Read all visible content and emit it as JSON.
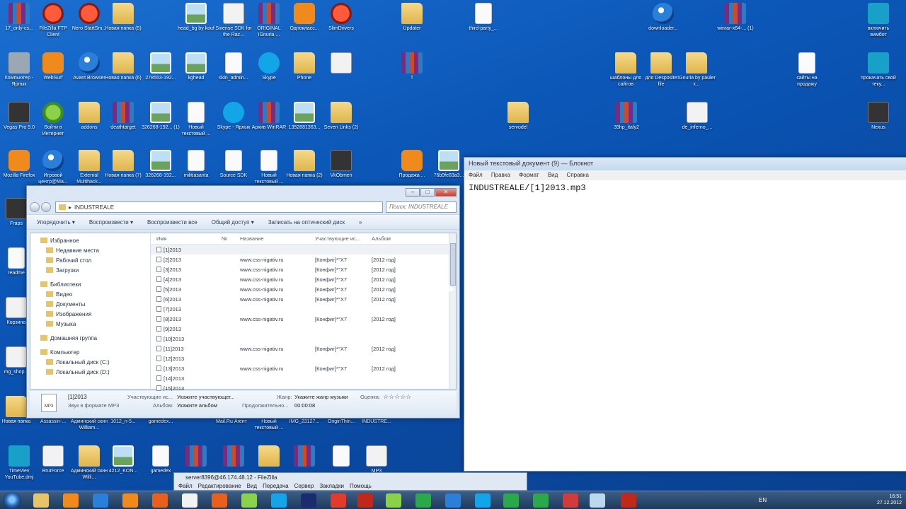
{
  "desktop": {
    "icons": [
      {
        "label": "17_only-cs...",
        "glyph": "rar"
      },
      {
        "label": "FileZilla FTP Client",
        "glyph": "red"
      },
      {
        "label": "Nero StartSm...",
        "glyph": "red"
      },
      {
        "label": "Новая папка (5)",
        "glyph": "folder"
      },
      {
        "label": "head_bg by kouf",
        "glyph": "img"
      },
      {
        "label": "Sixense SDK for the Raz...",
        "glyph": "white"
      },
      {
        "label": "ORIGINAL IGnuria ...",
        "glyph": "rar"
      },
      {
        "label": "Однокласс...",
        "glyph": "orange"
      },
      {
        "label": "SlimDrivers",
        "glyph": "red"
      },
      {
        "label": "Updater",
        "glyph": "folder"
      },
      {
        "label": "third-party_...",
        "glyph": "doc"
      },
      {
        "label": "downloader...",
        "glyph": "app"
      },
      {
        "label": "winrar-x64-... (1)",
        "glyph": "rar"
      },
      {
        "label": "включить вимбот",
        "glyph": "teal"
      },
      {
        "label": "Компьютер - Ярлык",
        "glyph": "gray"
      },
      {
        "label": "WebSurf",
        "glyph": "orange"
      },
      {
        "label": "Avant Browser",
        "glyph": "app"
      },
      {
        "label": "Новая папка (6)",
        "glyph": "folder"
      },
      {
        "label": "278553-192...",
        "glyph": "img"
      },
      {
        "label": "kghead",
        "glyph": "img"
      },
      {
        "label": "skin_admin...",
        "glyph": "doc"
      },
      {
        "label": "Skype",
        "glyph": "skype"
      },
      {
        "label": "Phone",
        "glyph": "folder"
      },
      {
        "label": "",
        "glyph": "white"
      },
      {
        "label": "T",
        "glyph": "rar"
      },
      {
        "label": "шаблоны для сайтов",
        "glyph": "folder"
      },
      {
        "label": "для Desposite file",
        "glyph": "folder"
      },
      {
        "label": "IGnuria by pauler x...",
        "glyph": "folder"
      },
      {
        "label": "сайты на продажу",
        "glyph": "doc"
      },
      {
        "label": "прокачать свой теку...",
        "glyph": "teal"
      },
      {
        "label": "Vegas Pro 9.0",
        "glyph": "dark"
      },
      {
        "label": "Войти в Интернет",
        "glyph": "green"
      },
      {
        "label": "addons",
        "glyph": "folder"
      },
      {
        "label": "deathtarget",
        "glyph": "rar"
      },
      {
        "label": "326268-192... (1)",
        "glyph": "img"
      },
      {
        "label": "Новый текстовый ...",
        "glyph": "doc"
      },
      {
        "label": "Skype - Ярлык",
        "glyph": "skype"
      },
      {
        "label": "Архив WinRAR",
        "glyph": "rar"
      },
      {
        "label": "1352881363...",
        "glyph": "img"
      },
      {
        "label": "Seven Links (2)",
        "glyph": "folder"
      },
      {
        "label": "servodel",
        "glyph": "folder"
      },
      {
        "label": "35hp_italy2",
        "glyph": "rar"
      },
      {
        "label": "de_inferno_...",
        "glyph": "white"
      },
      {
        "label": "Nexus",
        "glyph": "dark"
      },
      {
        "label": "Mozilla Firefox",
        "glyph": "orange"
      },
      {
        "label": "Игровой центр@Ma...",
        "glyph": "app"
      },
      {
        "label": "External Multihack...",
        "glyph": "folder"
      },
      {
        "label": "Новая папка (7)",
        "glyph": "folder"
      },
      {
        "label": "326268-192...",
        "glyph": "img"
      },
      {
        "label": "militiasanta",
        "glyph": "doc"
      },
      {
        "label": "Source SDK",
        "glyph": "doc"
      },
      {
        "label": "Новый текстовый ...",
        "glyph": "doc"
      },
      {
        "label": "Новая папка (2)",
        "glyph": "folder"
      },
      {
        "label": "VkObmen",
        "glyph": "dark"
      },
      {
        "label": "Продажа ...",
        "glyph": "orange"
      },
      {
        "label": "76b9fe83a3...",
        "glyph": "img"
      },
      {
        "label": "Fraps",
        "glyph": "dark"
      },
      {
        "label": "readme",
        "glyph": "doc"
      },
      {
        "label": "Корзина",
        "glyph": "white"
      },
      {
        "label": "mg_shop...",
        "glyph": "white"
      },
      {
        "label": "Новая папка",
        "glyph": "folder"
      },
      {
        "label": "Assassin-...",
        "glyph": "folder"
      },
      {
        "label": "Админский скин William...",
        "glyph": "folder"
      },
      {
        "label": "1012_n-5...",
        "glyph": "img"
      },
      {
        "label": "gamedex...",
        "glyph": "doc"
      },
      {
        "label": "Mail.Ru Агент",
        "glyph": "app"
      },
      {
        "label": "Новый текстовый ...",
        "glyph": "doc"
      },
      {
        "label": "IMG_23127...",
        "glyph": "img"
      },
      {
        "label": "OriginThin...",
        "glyph": "img"
      },
      {
        "label": "INDUSTRE...",
        "glyph": "folder"
      },
      {
        "label": "TimeViev YouTube.dmj",
        "glyph": "teal"
      },
      {
        "label": "BrutForce",
        "glyph": "white"
      },
      {
        "label": "Админский скин Willi...",
        "glyph": "folder"
      },
      {
        "label": "4212_KON...",
        "glyph": "img"
      },
      {
        "label": "gamedex",
        "glyph": "doc"
      },
      {
        "label": "",
        "glyph": "rar"
      },
      {
        "label": "",
        "glyph": "rar"
      },
      {
        "label": "",
        "glyph": "folder"
      },
      {
        "label": "",
        "glyph": "rar"
      },
      {
        "label": "",
        "glyph": "doc"
      },
      {
        "label": "MP3",
        "glyph": "white"
      }
    ]
  },
  "notepad": {
    "title": "Новый текстовый документ (9) — Блокнот",
    "menu": [
      "Файл",
      "Правка",
      "Формат",
      "Вид",
      "Справка"
    ],
    "content": "INDUSTREALE/[1]2013.mp3"
  },
  "explorer": {
    "path": "INDUSTREALE",
    "search_placeholder": "Поиск: INDUSTREALE",
    "toolbar": [
      "Упорядочить ▾",
      "Воспроизвести ▾",
      "Воспроизвести все",
      "Общий доступ ▾",
      "Записать на оптический диск",
      "»"
    ],
    "nav": [
      {
        "label": "Избранное",
        "level": 1
      },
      {
        "label": "Недавние места",
        "level": 2
      },
      {
        "label": "Рабочий стол",
        "level": 2
      },
      {
        "label": "Загрузки",
        "level": 2
      },
      {
        "label": "",
        "level": 0
      },
      {
        "label": "Библиотеки",
        "level": 1
      },
      {
        "label": "Видео",
        "level": 2
      },
      {
        "label": "Документы",
        "level": 2
      },
      {
        "label": "Изображения",
        "level": 2
      },
      {
        "label": "Музыка",
        "level": 2
      },
      {
        "label": "",
        "level": 0
      },
      {
        "label": "Домашняя группа",
        "level": 1
      },
      {
        "label": "",
        "level": 0
      },
      {
        "label": "Компьютер",
        "level": 1
      },
      {
        "label": "Локальный диск (C:)",
        "level": 2
      },
      {
        "label": "Локальный диск (D:)",
        "level": 2
      }
    ],
    "columns": [
      "Имя",
      "№",
      "Название",
      "Участвующие ис...",
      "Альбом"
    ],
    "files": [
      {
        "name": "[1]2013",
        "num": "",
        "title": "",
        "artist": "",
        "album": ""
      },
      {
        "name": "[2]2013",
        "num": "",
        "title": "www.css-nigativ.ru",
        "artist": "[Конфиг]*°X7",
        "album": "[2012 год]"
      },
      {
        "name": "[3]2013",
        "num": "",
        "title": "www.css-nigativ.ru",
        "artist": "[Конфиг]*°X7",
        "album": "[2012 год]"
      },
      {
        "name": "[4]2013",
        "num": "",
        "title": "www.css-nigativ.ru",
        "artist": "[Конфиг]*°X7",
        "album": "[2012 год]"
      },
      {
        "name": "[5]2013",
        "num": "",
        "title": "www.css-nigativ.ru",
        "artist": "[Конфиг]*°X7",
        "album": "[2012 год]"
      },
      {
        "name": "[6]2013",
        "num": "",
        "title": "www.css-nigativ.ru",
        "artist": "[Конфиг]*°X7",
        "album": "[2012 год]"
      },
      {
        "name": "[7]2013",
        "num": "",
        "title": "",
        "artist": "",
        "album": ""
      },
      {
        "name": "[8]2013",
        "num": "",
        "title": "www.css-nigativ.ru",
        "artist": "[Конфиг]*°X7",
        "album": "[2012 год]"
      },
      {
        "name": "[9]2013",
        "num": "",
        "title": "",
        "artist": "",
        "album": ""
      },
      {
        "name": "[10]2013",
        "num": "",
        "title": "",
        "artist": "",
        "album": ""
      },
      {
        "name": "[11]2013",
        "num": "",
        "title": "www.css-nigativ.ru",
        "artist": "[Конфиг]*°X7",
        "album": "[2012 год]"
      },
      {
        "name": "[12]2013",
        "num": "",
        "title": "",
        "artist": "",
        "album": ""
      },
      {
        "name": "[13]2013",
        "num": "",
        "title": "www.css-nigativ.ru",
        "artist": "[Конфиг]*°X7",
        "album": "[2012 год]"
      },
      {
        "name": "[14]2013",
        "num": "",
        "title": "",
        "artist": "",
        "album": ""
      },
      {
        "name": "[15]2013",
        "num": "",
        "title": "",
        "artist": "",
        "album": ""
      }
    ],
    "details": {
      "name": "[1]2013",
      "type": "Звук в формате MP3",
      "artist_label": "Участвующие ис...",
      "artist_value": "Укажите участвующег...",
      "album_label": "Альбом:",
      "album_value": "Укажите альбом",
      "genre_label": "Жанр:",
      "genre_value": "Укажите жанр музыки",
      "duration_label": "Продолжительно...",
      "duration_value": "00:00:08",
      "rating_label": "Оценка:",
      "rating_stars": "☆☆☆☆☆",
      "icon_label": "MP3"
    }
  },
  "filezilla": {
    "title": "server8396@46.174.48.12 - FileZilla",
    "menu": [
      "Файл",
      "Редактирование",
      "Вид",
      "Передача",
      "Сервер",
      "Закладки",
      "Помощь"
    ]
  },
  "taskbar": {
    "lang": "EN",
    "time": "16:51",
    "date": "27.12.2012",
    "apps": [
      "explorer",
      "media-player",
      "mail",
      "odnoklassniki",
      "firefox",
      "notepad",
      "browser-orange",
      "greenshot",
      "skype",
      "photoshop",
      "app-red",
      "filezilla",
      "browser-green",
      "chrome",
      "avant",
      "skype-2",
      "chrome-2",
      "mailru",
      "record",
      "unknown",
      "filezilla-2"
    ]
  }
}
